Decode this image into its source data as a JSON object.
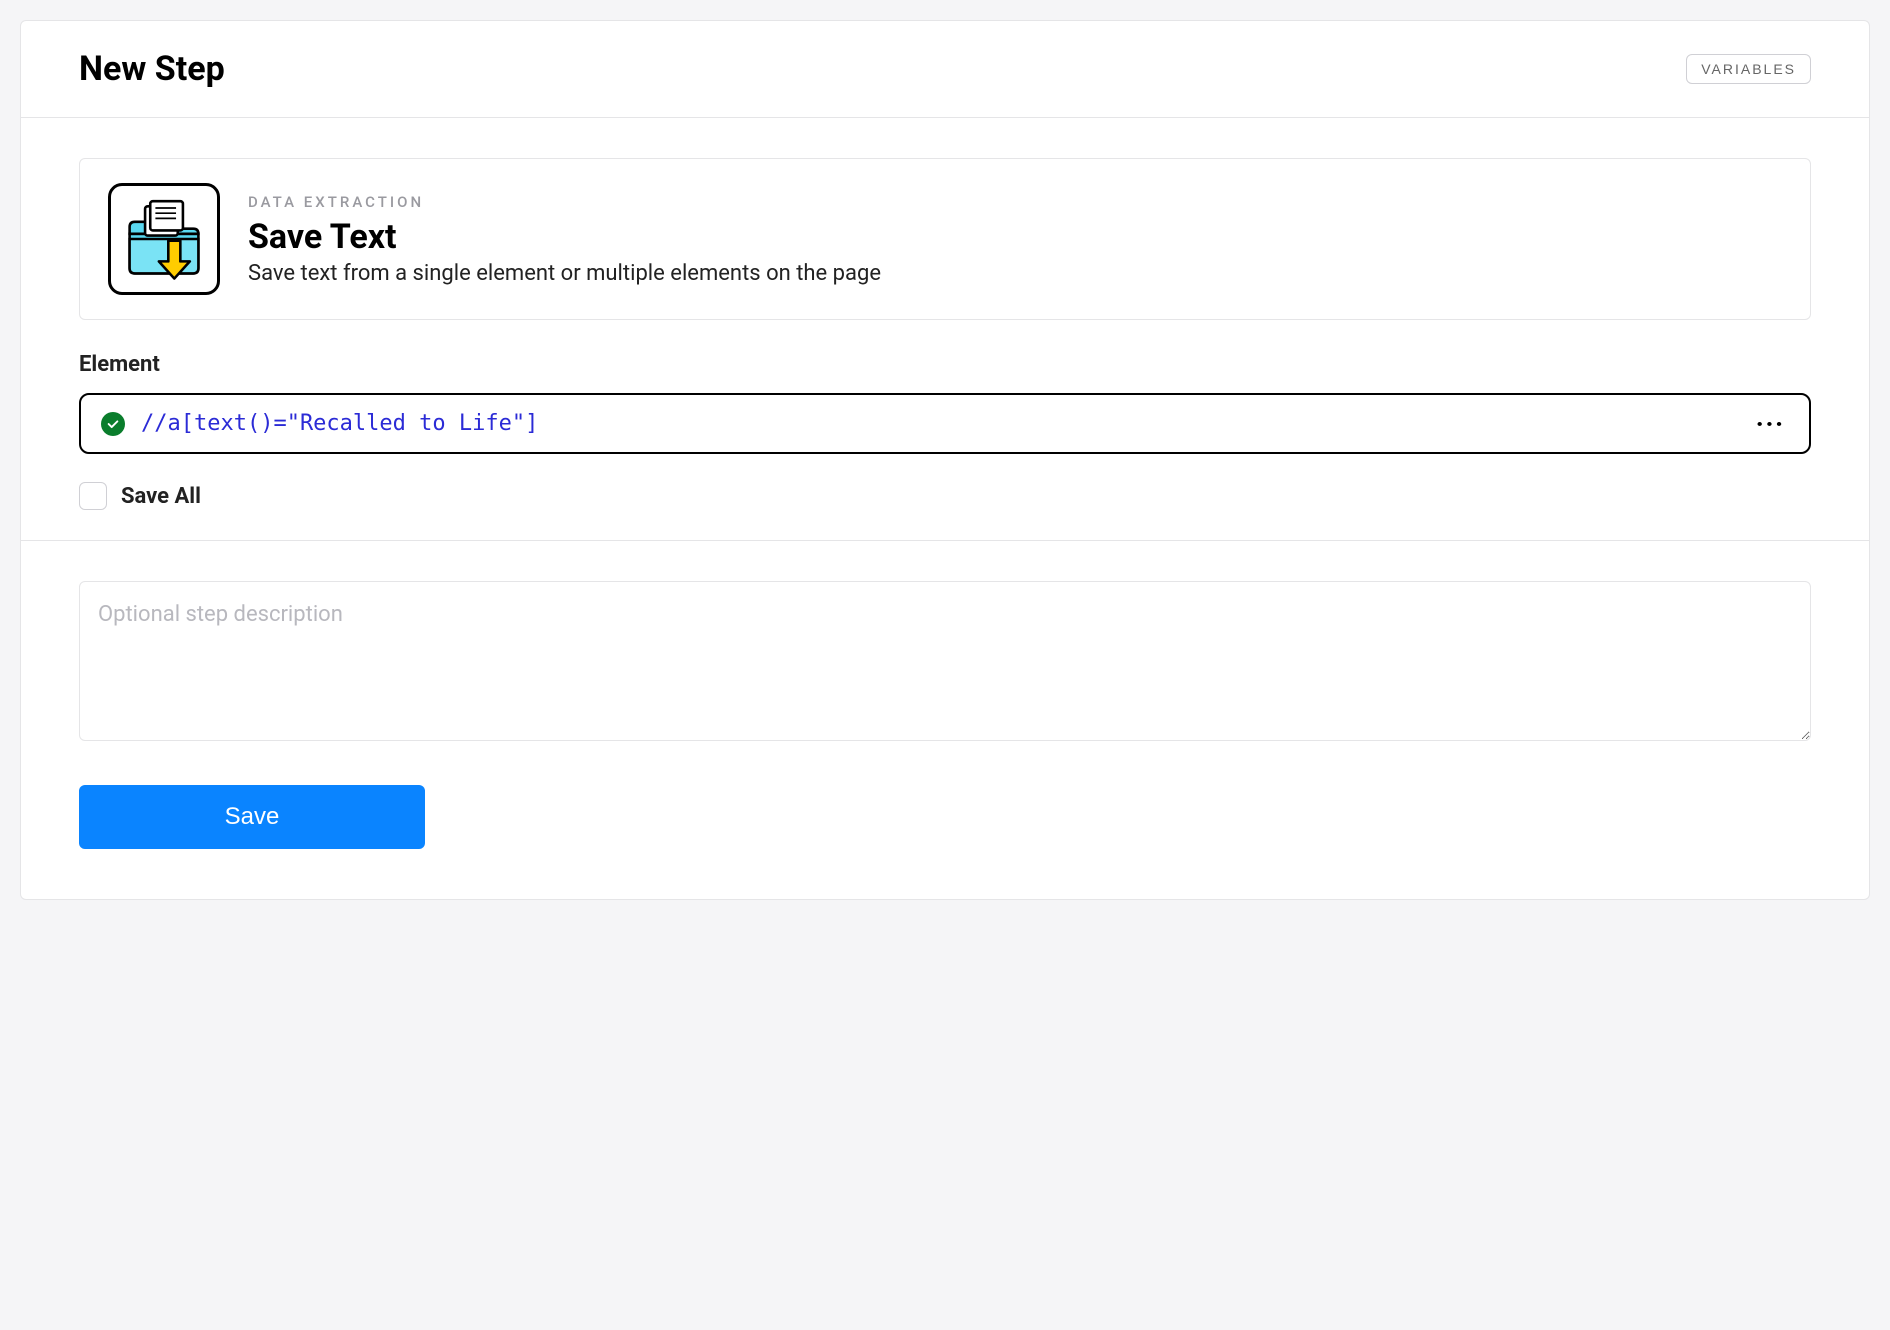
{
  "header": {
    "title": "New Step",
    "variables_button": "VARIABLES"
  },
  "step": {
    "category": "DATA EXTRACTION",
    "name": "Save Text",
    "description": "Save text from a single element or multiple elements on the page",
    "icon_name": "folder-download-icon"
  },
  "element_field": {
    "label": "Element",
    "value": "//a[text()=\"Recalled to Life\"]",
    "valid": true
  },
  "save_all": {
    "label": "Save All",
    "checked": false
  },
  "description_field": {
    "placeholder": "Optional step description",
    "value": ""
  },
  "actions": {
    "save_label": "Save"
  }
}
